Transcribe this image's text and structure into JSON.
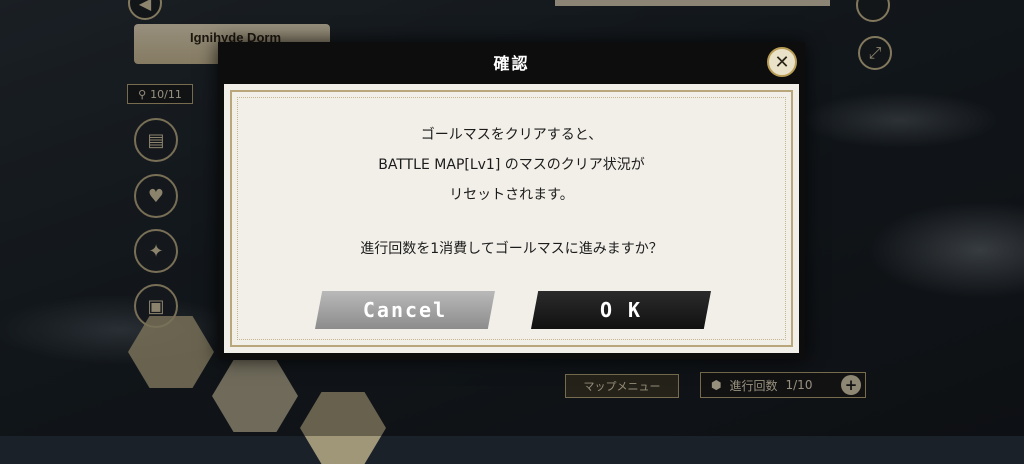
{
  "background": {
    "dorm_label": "Ignihyde Dorm",
    "stage_counter": "10/11",
    "map_menu_label": "マップメニュー",
    "progress_label": "進行回数",
    "progress_value": "1/10",
    "progress_plus": "+"
  },
  "dialog": {
    "title": "確認",
    "close_symbol": "✕",
    "message_lines": [
      "ゴールマスをクリアすると、",
      "BATTLE MAP[Lv1] のマスのクリア状況が",
      "リセットされます。"
    ],
    "question": "進行回数を1消費してゴールマスに進みますか？",
    "cancel_label": "Cancel",
    "ok_label": "O K"
  },
  "colors": {
    "paper": "#f2efe8",
    "frame": "#0d0d0d",
    "gold": "#b9a67a",
    "cancel": "#a0a0a0",
    "ok": "#1a1a1a"
  },
  "icons": [
    "pin-icon",
    "card-icon",
    "heart-icon",
    "lightbulb-icon",
    "treasure-chest-icon",
    "expand-icon",
    "close-icon",
    "gem-icon",
    "plus-icon"
  ]
}
